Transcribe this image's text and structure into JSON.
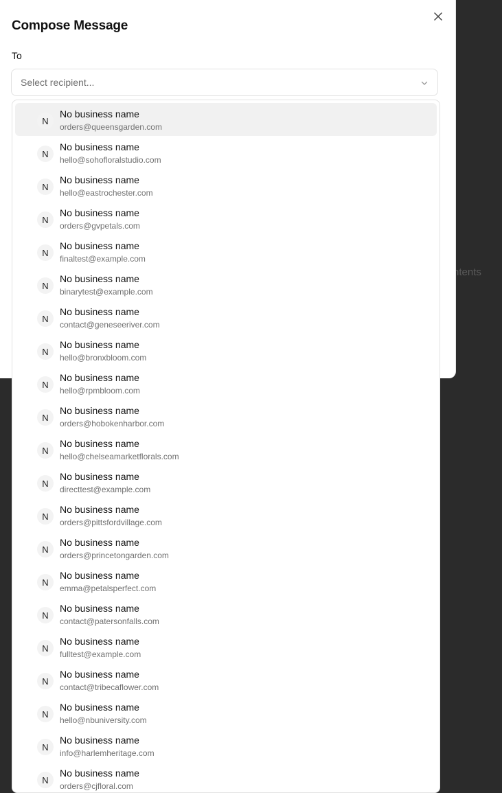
{
  "background": {
    "fragment_text": "ntents"
  },
  "dialog": {
    "title": "Compose Message",
    "close_icon": "close-icon",
    "to_label": "To",
    "recipient_select": {
      "placeholder": "Select recipient...",
      "icon": "chevron-down-icon"
    }
  },
  "dropdown": {
    "options": [
      {
        "initial": "N",
        "name": "No business name",
        "email": "orders@queensgarden.com",
        "highlighted": true
      },
      {
        "initial": "N",
        "name": "No business name",
        "email": "hello@sohofloralstudio.com"
      },
      {
        "initial": "N",
        "name": "No business name",
        "email": "hello@eastrochester.com"
      },
      {
        "initial": "N",
        "name": "No business name",
        "email": "orders@gvpetals.com"
      },
      {
        "initial": "N",
        "name": "No business name",
        "email": "finaltest@example.com"
      },
      {
        "initial": "N",
        "name": "No business name",
        "email": "binarytest@example.com"
      },
      {
        "initial": "N",
        "name": "No business name",
        "email": "contact@geneseeriver.com"
      },
      {
        "initial": "N",
        "name": "No business name",
        "email": "hello@bronxbloom.com"
      },
      {
        "initial": "N",
        "name": "No business name",
        "email": "hello@rpmbloom.com"
      },
      {
        "initial": "N",
        "name": "No business name",
        "email": "orders@hobokenharbor.com"
      },
      {
        "initial": "N",
        "name": "No business name",
        "email": "hello@chelseamarketflorals.com"
      },
      {
        "initial": "N",
        "name": "No business name",
        "email": "directtest@example.com"
      },
      {
        "initial": "N",
        "name": "No business name",
        "email": "orders@pittsfordvillage.com"
      },
      {
        "initial": "N",
        "name": "No business name",
        "email": "orders@princetongarden.com"
      },
      {
        "initial": "N",
        "name": "No business name",
        "email": "emma@petalsperfect.com"
      },
      {
        "initial": "N",
        "name": "No business name",
        "email": "contact@patersonfalls.com"
      },
      {
        "initial": "N",
        "name": "No business name",
        "email": "fulltest@example.com"
      },
      {
        "initial": "N",
        "name": "No business name",
        "email": "contact@tribecaflower.com"
      },
      {
        "initial": "N",
        "name": "No business name",
        "email": "hello@nbuniversity.com"
      },
      {
        "initial": "N",
        "name": "No business name",
        "email": "info@harlemheritage.com"
      },
      {
        "initial": "N",
        "name": "No business name",
        "email": "orders@cjfloral.com"
      }
    ]
  }
}
